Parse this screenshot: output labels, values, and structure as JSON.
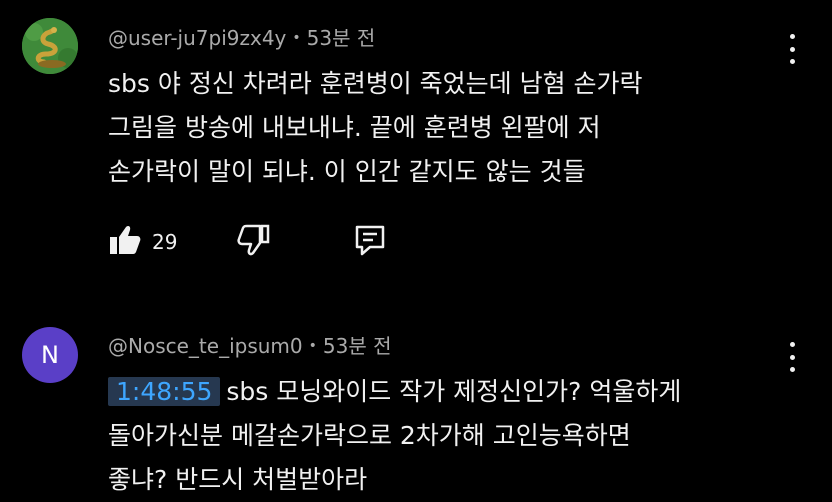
{
  "comments": [
    {
      "author": "@user-ju7pi9zx4y",
      "time": "53분 전",
      "lines": [
        "sbs 야 정신 차려라 훈련병이 죽었는데 남혐 손가락",
        "그림을 방송에 내보내냐. 끝에 훈련병 왼팔에 저",
        "손가락이 말이 되냐. 이 인간 같지도 않는 것들"
      ],
      "likes": "29",
      "avatar_icon": "snake-avatar-icon",
      "avatar_color": "#3f8a3a"
    },
    {
      "author": "@Nosce_te_ipsum0",
      "time": "53분 전",
      "timestamp_link": "1:48:55",
      "first_line_rest": "sbs 모닝와이드 작가 제정신인가? 억울하게",
      "lines": [
        "돌아가신분 메갈손가락으로 2차가해 고인능욕하면",
        "좋냐? 반드시 처벌받아라"
      ],
      "avatar_letter": "N",
      "avatar_color": "#5a3fc7"
    }
  ],
  "separator": "•",
  "colors": {
    "background": "#000000",
    "text": "#f1f1f1",
    "meta": "#aaaaaa",
    "timestamp_text": "#3ea6ff",
    "timestamp_bg": "#263850"
  }
}
